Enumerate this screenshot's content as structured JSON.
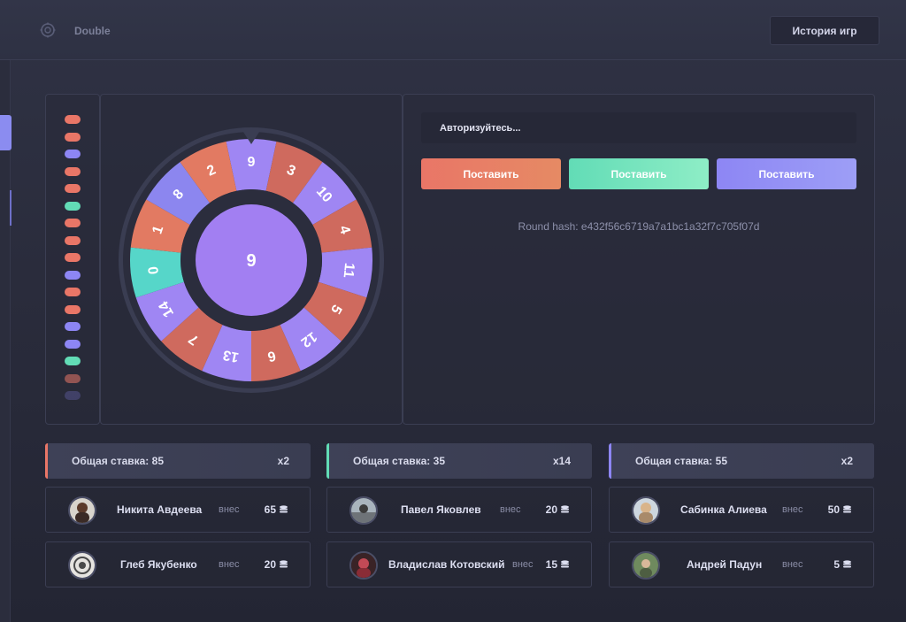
{
  "header": {
    "game_title": "Double",
    "history_button": "История игр"
  },
  "icons": {
    "logo": "gear-logo-icon",
    "coin": "coins-icon"
  },
  "colors": {
    "red": "#e97667",
    "green": "#62dcb6",
    "purple": "#8d86f4",
    "background": "#2a2c3c"
  },
  "history": [
    "red",
    "red",
    "purple",
    "red",
    "red",
    "green",
    "red",
    "red",
    "red",
    "purple",
    "red",
    "red",
    "purple",
    "purple",
    "green",
    "red",
    "purple"
  ],
  "wheel": {
    "center_value": "9",
    "segments": [
      {
        "label": "9",
        "color": "purple"
      },
      {
        "label": "3",
        "color": "red"
      },
      {
        "label": "10",
        "color": "purple"
      },
      {
        "label": "4",
        "color": "red"
      },
      {
        "label": "11",
        "color": "purple"
      },
      {
        "label": "5",
        "color": "red"
      },
      {
        "label": "12",
        "color": "purple"
      },
      {
        "label": "6",
        "color": "red"
      },
      {
        "label": "13",
        "color": "purple"
      },
      {
        "label": "7",
        "color": "red"
      },
      {
        "label": "14",
        "color": "purple"
      },
      {
        "label": "0",
        "color": "green"
      },
      {
        "label": "1",
        "color": "red"
      },
      {
        "label": "8",
        "color": "purple"
      },
      {
        "label": "2",
        "color": "red"
      }
    ]
  },
  "auth_text": "Авторизуйтесь...",
  "bet_buttons": {
    "red": "Поставить",
    "green": "Поставить",
    "purple": "Поставить"
  },
  "round_hash": "Round hash: e432f56c6719a7a1bc1a32f7c705f07d",
  "columns": [
    {
      "total_label": "Общая ставка:",
      "total": "85",
      "multiplier": "x2",
      "players": [
        {
          "name": "Никита Авдеева",
          "action": "внес",
          "amount": "65"
        },
        {
          "name": "Глеб Якубенко",
          "action": "внес",
          "amount": "20"
        }
      ]
    },
    {
      "total_label": "Общая ставка:",
      "total": "35",
      "multiplier": "x14",
      "players": [
        {
          "name": "Павел Яковлев",
          "action": "внес",
          "amount": "20"
        },
        {
          "name": "Владислав Котовский",
          "action": "внес",
          "amount": "15"
        }
      ]
    },
    {
      "total_label": "Общая ставка:",
      "total": "55",
      "multiplier": "x2",
      "players": [
        {
          "name": "Сабинка Алиева",
          "action": "внес",
          "amount": "50"
        },
        {
          "name": "Андрей Падун",
          "action": "внес",
          "amount": "5"
        }
      ]
    }
  ]
}
